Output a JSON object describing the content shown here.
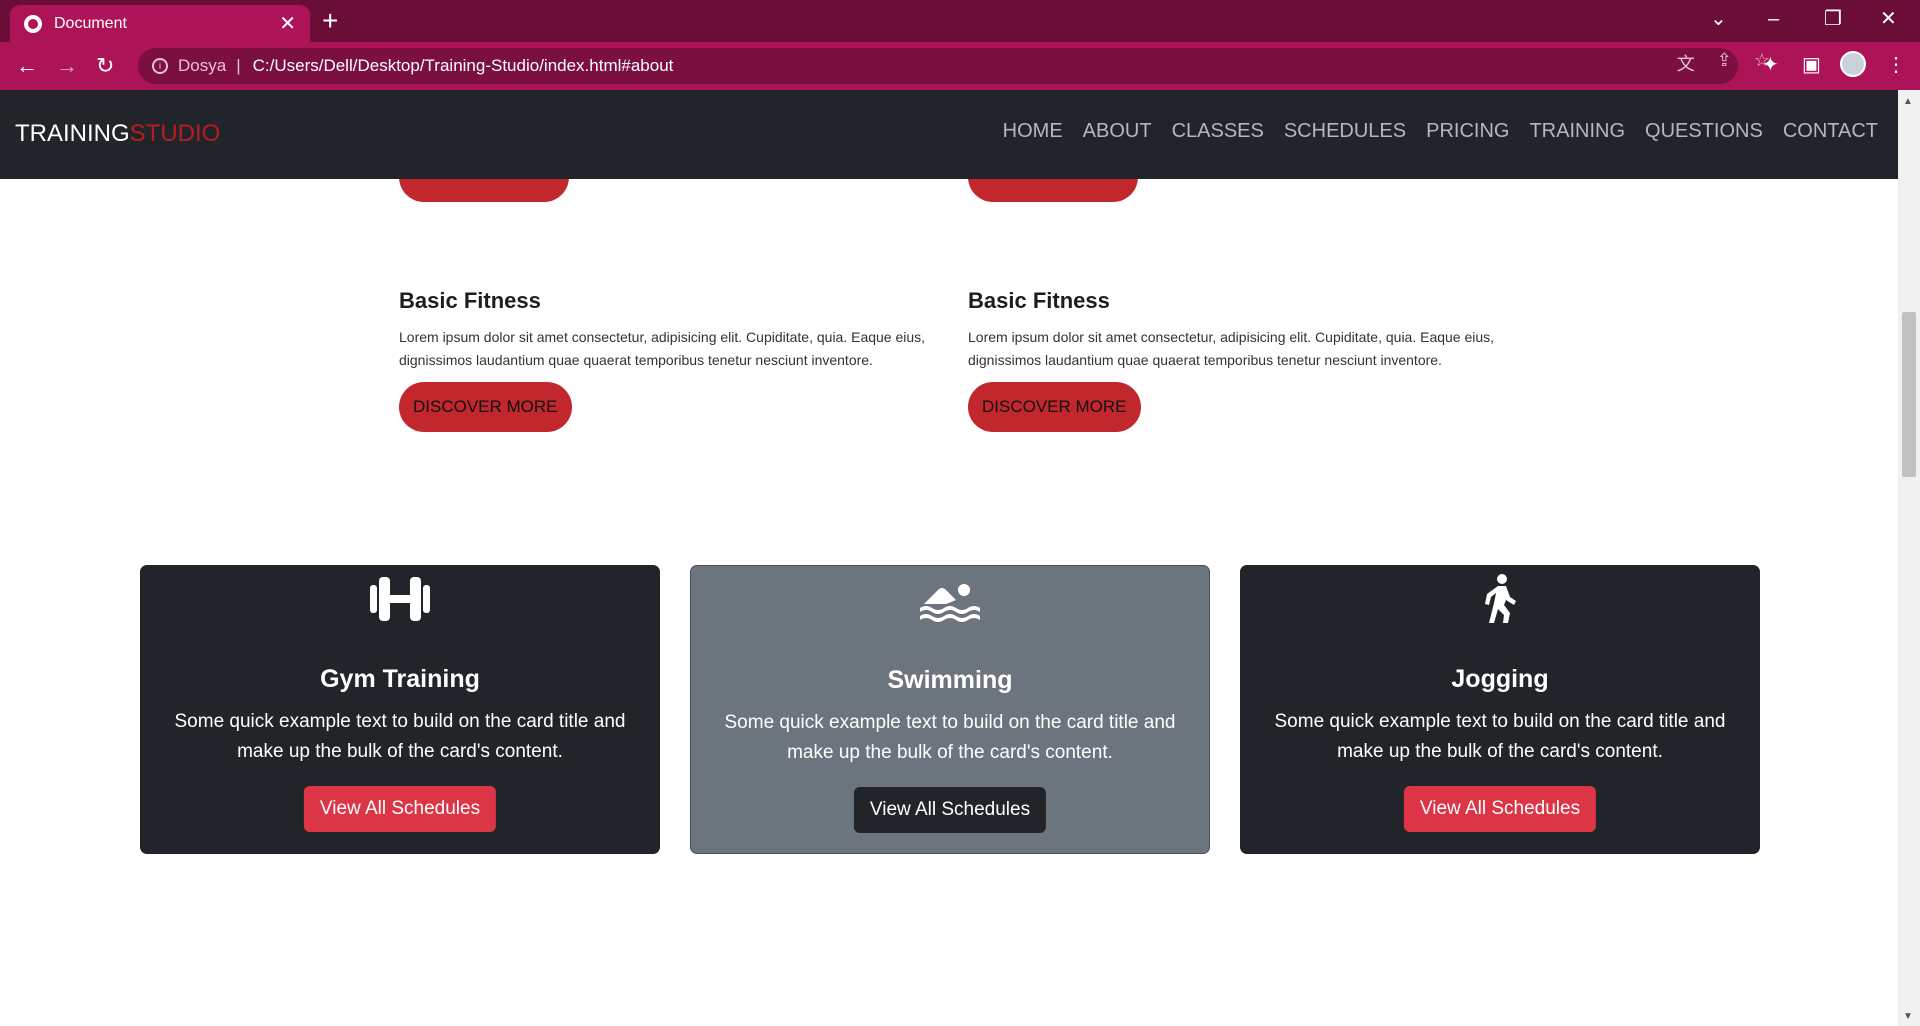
{
  "browser": {
    "tab_title": "Document",
    "tab_close": "✕",
    "new_tab": "+",
    "address_site": "Dosya",
    "address_separator": "|",
    "address_url": "C:/Users/Dell/Desktop/Training-Studio/index.html#about"
  },
  "navbar": {
    "brand_main": "TRAINING",
    "brand_accent": "STUDIO",
    "items": [
      "HOME",
      "ABOUT",
      "CLASSES",
      "SCHEDULES",
      "PRICING",
      "TRAINING",
      "QUESTIONS",
      "CONTACT"
    ]
  },
  "fitness": [
    {
      "title": "Basic Fitness",
      "text": "Lorem ipsum dolor sit amet consectetur, adipisicing elit. Cupiditate, quia. Eaque eius, dignissimos laudantium quae quaerat temporibus tenetur nesciunt inventore.",
      "button": "DISCOVER MORE"
    },
    {
      "title": "Basic Fitness",
      "text": "Lorem ipsum dolor sit amet consectetur, adipisicing elit. Cupiditate, quia. Eaque eius, dignissimos laudantium quae quaerat temporibus tenetur nesciunt inventore.",
      "button": "DISCOVER MORE"
    }
  ],
  "cards": [
    {
      "icon": "dumbbell-icon",
      "title": "Gym Training",
      "text": "Some quick example text to build on the card title and make up the bulk of the card's content.",
      "button": "View All Schedules"
    },
    {
      "icon": "swimmer-icon",
      "title": "Swimming",
      "text": "Some quick example text to build on the card title and make up the bulk of the card's content.",
      "button": "View All Schedules"
    },
    {
      "icon": "walker-icon",
      "title": "Jogging",
      "text": "Some quick example text to build on the card title and make up the bulk of the card's content.",
      "button": "View All Schedules"
    }
  ],
  "colors": {
    "browser_frame": "#6a0d37",
    "browser_toolbar": "#ad1457",
    "navbar_bg": "#212529",
    "brand_accent": "#b81c22",
    "discover_btn": "#c1272d",
    "card_dark": "#212529",
    "card_gray": "#6c757d",
    "btn_red": "#dc3545"
  }
}
